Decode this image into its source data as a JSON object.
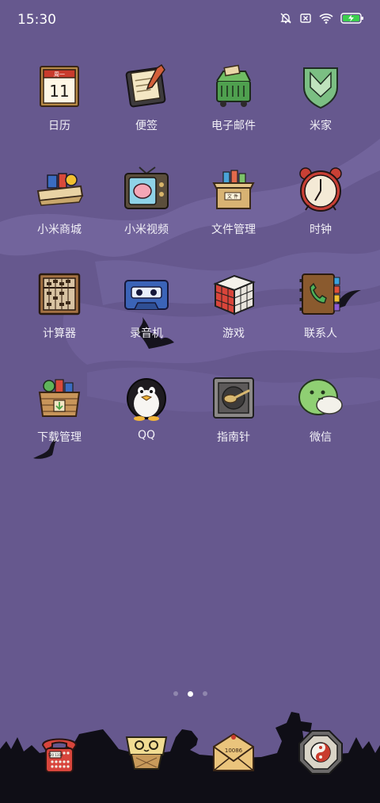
{
  "status_bar": {
    "time": "15:30",
    "icons": [
      "bell-off-icon",
      "sim-x-icon",
      "wifi-icon",
      "battery-charging-icon"
    ]
  },
  "home_apps": [
    {
      "label": "日历",
      "icon": "calendar-icon",
      "calendar_weekday": "周一",
      "calendar_day": "11"
    },
    {
      "label": "便签",
      "icon": "notes-icon"
    },
    {
      "label": "电子邮件",
      "icon": "mail-cart-icon"
    },
    {
      "label": "米家",
      "icon": "mijia-shield-icon"
    },
    {
      "label": "小米商城",
      "icon": "shop-crate-icon"
    },
    {
      "label": "小米视频",
      "icon": "tv-icon"
    },
    {
      "label": "文件管理",
      "icon": "file-box-icon",
      "box_label": "文 件"
    },
    {
      "label": "时钟",
      "icon": "alarm-clock-icon"
    },
    {
      "label": "计算器",
      "icon": "abacus-icon"
    },
    {
      "label": "录音机",
      "icon": "cassette-icon"
    },
    {
      "label": "游戏",
      "icon": "rubiks-cube-icon"
    },
    {
      "label": "联系人",
      "icon": "contacts-book-icon"
    },
    {
      "label": "下载管理",
      "icon": "download-basket-icon"
    },
    {
      "label": "QQ",
      "icon": "qq-penguin-icon"
    },
    {
      "label": "指南针",
      "icon": "compass-spoon-icon"
    },
    {
      "label": "微信",
      "icon": "wechat-blob-icon"
    }
  ],
  "page_indicator": {
    "count": 3,
    "active_index": 1
  },
  "dock_apps": [
    {
      "icon": "phone-icon",
      "name": "电话",
      "phone_screen": "520 1314"
    },
    {
      "icon": "sms-bowl-icon",
      "name": "短信"
    },
    {
      "icon": "envelope-icon",
      "name": "邮件",
      "envelope_text": "10086"
    },
    {
      "icon": "yin-yang-icon",
      "name": "设置"
    }
  ],
  "colors": {
    "background": "#66588e",
    "fog": "#7c6fa6",
    "silhouette": "#101018",
    "label": "#f2f0f7"
  }
}
